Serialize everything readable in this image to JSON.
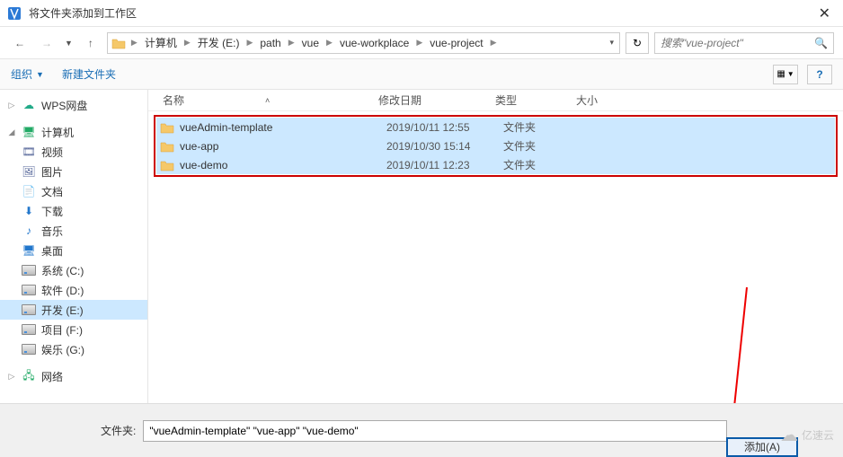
{
  "title": "将文件夹添加到工作区",
  "breadcrumbs": [
    "计算机",
    "开发 (E:)",
    "path",
    "vue",
    "vue-workplace",
    "vue-project"
  ],
  "search_placeholder": "搜索\"vue-project\"",
  "toolbar": {
    "organize": "组织",
    "new_folder": "新建文件夹"
  },
  "sidebar": {
    "wps": "WPS网盘",
    "computer": "计算机",
    "computer_children": [
      "视频",
      "图片",
      "文档",
      "下载",
      "音乐",
      "桌面",
      "系统 (C:)",
      "软件 (D:)",
      "开发 (E:)",
      "项目 (F:)",
      "娱乐 (G:)"
    ],
    "network": "网络"
  },
  "columns": {
    "name": "名称",
    "date": "修改日期",
    "type": "类型",
    "size": "大小"
  },
  "files": [
    {
      "name": "vueAdmin-template",
      "date": "2019/10/11 12:55",
      "type": "文件夹"
    },
    {
      "name": "vue-app",
      "date": "2019/10/30 15:14",
      "type": "文件夹"
    },
    {
      "name": "vue-demo",
      "date": "2019/10/11 12:23",
      "type": "文件夹"
    }
  ],
  "footer": {
    "label": "文件夹:",
    "value": "\"vueAdmin-template\" \"vue-app\" \"vue-demo\"",
    "add_button": "添加(A)"
  },
  "watermark": "亿速云"
}
